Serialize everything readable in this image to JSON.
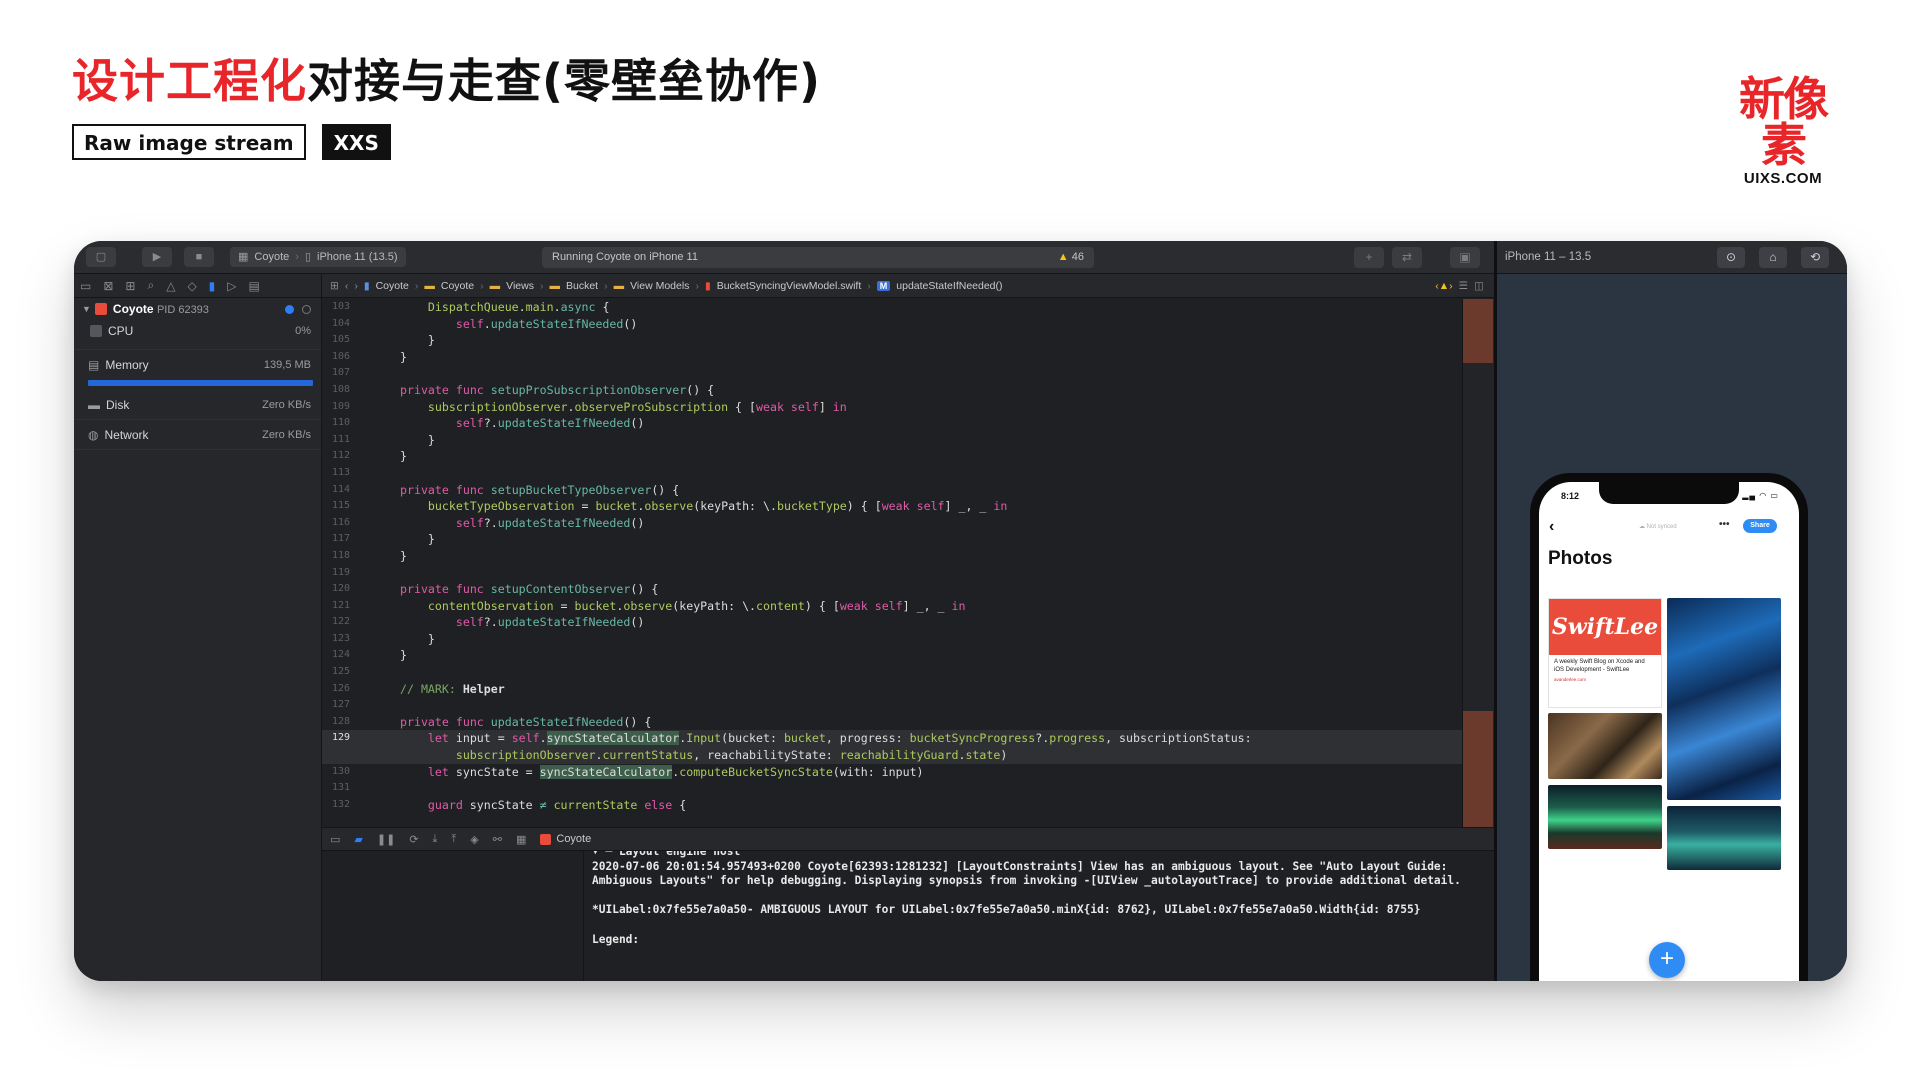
{
  "slide": {
    "title_red": "设计工程化",
    "title_black": "对接与走查(零壁垒协作)",
    "tag_outline": "Raw image stream",
    "tag_solid": "XXS",
    "brand_mark": "新像素",
    "brand_sub": "UIXS.COM"
  },
  "toolbar": {
    "scheme_app": "Coyote",
    "scheme_device": "iPhone 11 (13.5)",
    "status": "Running Coyote on iPhone 11",
    "warning_count": "46"
  },
  "navigator": {
    "process_name": "Coyote",
    "process_pid": "PID 62393",
    "rows": [
      {
        "label": "CPU",
        "value": "0%"
      },
      {
        "label": "Memory",
        "value": "139,5 MB"
      },
      {
        "label": "Disk",
        "value": "Zero KB/s"
      },
      {
        "label": "Network",
        "value": "Zero KB/s"
      }
    ]
  },
  "jumpbar": [
    "Coyote",
    "Coyote",
    "Views",
    "Bucket",
    "View Models",
    "BucketSyncingViewModel.swift",
    "updateStateIfNeeded()"
  ],
  "code_lines": [
    "103",
    "104",
    "105",
    "106",
    "107",
    "108",
    "109",
    "110",
    "111",
    "112",
    "113",
    "114",
    "115",
    "116",
    "117",
    "118",
    "119",
    "120",
    "121",
    "122",
    "123",
    "124",
    "125",
    "126",
    "127",
    "128",
    "129",
    "",
    "130",
    "131",
    "132"
  ],
  "debug_target": "Coyote",
  "console": {
    "p0": "▾ ─ Layout engine host",
    "p1": "2020-07-06 20:01:54.957493+0200 Coyote[62393:1281232] [LayoutConstraints] View has an ambiguous layout. See \"Auto Layout Guide: Ambiguous Layouts\" for help debugging. Displaying synopsis from invoking -[UIView _autolayoutTrace] to provide additional detail.",
    "p2": "*UILabel:0x7fe55e7a0a50- AMBIGUOUS LAYOUT for UILabel:0x7fe55e7a0a50.minX{id: 8762}, UILabel:0x7fe55e7a0a50.Width{id: 8755}",
    "p3": "Legend:"
  },
  "simulator": {
    "title": "iPhone 11 – 13.5",
    "time": "8:12",
    "not_synced": "Not synced",
    "share": "Share",
    "heading": "Photos",
    "swift_title": "SwiftLee",
    "swift_desc": "A weekly Swift Blog on Xcode and iOS Development - SwiftLee",
    "swift_url": "avanderlee.com"
  },
  "colors": {
    "accent_red": "#e8262a",
    "xcode_blue": "#2f7ef6",
    "ios_blue": "#2f8cf4",
    "swiftlee_red": "#e94c3a"
  }
}
